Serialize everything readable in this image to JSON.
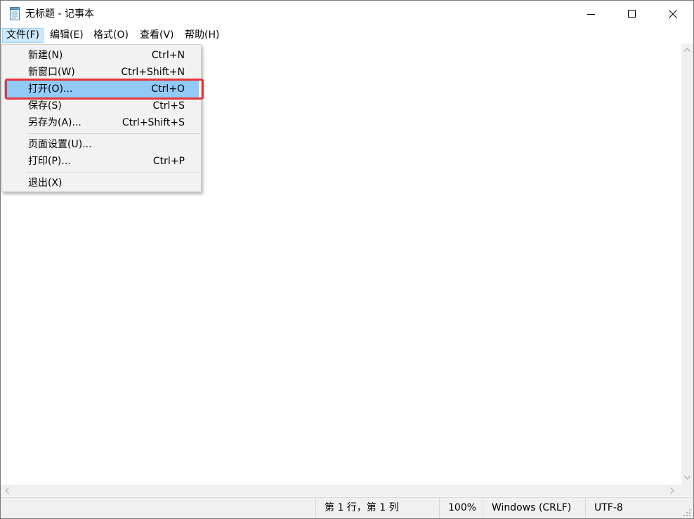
{
  "window": {
    "title": "无标题 - 记事本",
    "icon": "notepad-icon",
    "controls": {
      "minimize_icon": "minimize-icon",
      "maximize_icon": "maximize-icon",
      "close_icon": "close-icon"
    }
  },
  "menubar": {
    "items": [
      {
        "label": "文件(F)",
        "active": true
      },
      {
        "label": "编辑(E)"
      },
      {
        "label": "格式(O)"
      },
      {
        "label": "查看(V)"
      },
      {
        "label": "帮助(H)"
      }
    ]
  },
  "file_menu": {
    "items": [
      {
        "label": "新建(N)",
        "shortcut": "Ctrl+N"
      },
      {
        "label": "新窗口(W)",
        "shortcut": "Ctrl+Shift+N"
      },
      {
        "label": "打开(O)...",
        "shortcut": "Ctrl+O",
        "highlighted": true
      },
      {
        "label": "保存(S)",
        "shortcut": "Ctrl+S"
      },
      {
        "label": "另存为(A)...",
        "shortcut": "Ctrl+Shift+S"
      },
      {
        "label": "页面设置(U)..."
      },
      {
        "label": "打印(P)...",
        "shortcut": "Ctrl+P"
      },
      {
        "label": "退出(X)"
      }
    ]
  },
  "statusbar": {
    "position": "第 1 行，第 1 列",
    "zoom": "100%",
    "line_ending": "Windows (CRLF)",
    "encoding": "UTF-8"
  },
  "colors": {
    "menu_highlight": "#91c9f7",
    "annotation_box": "#e8343c",
    "menubar_active": "#cce8ff"
  }
}
